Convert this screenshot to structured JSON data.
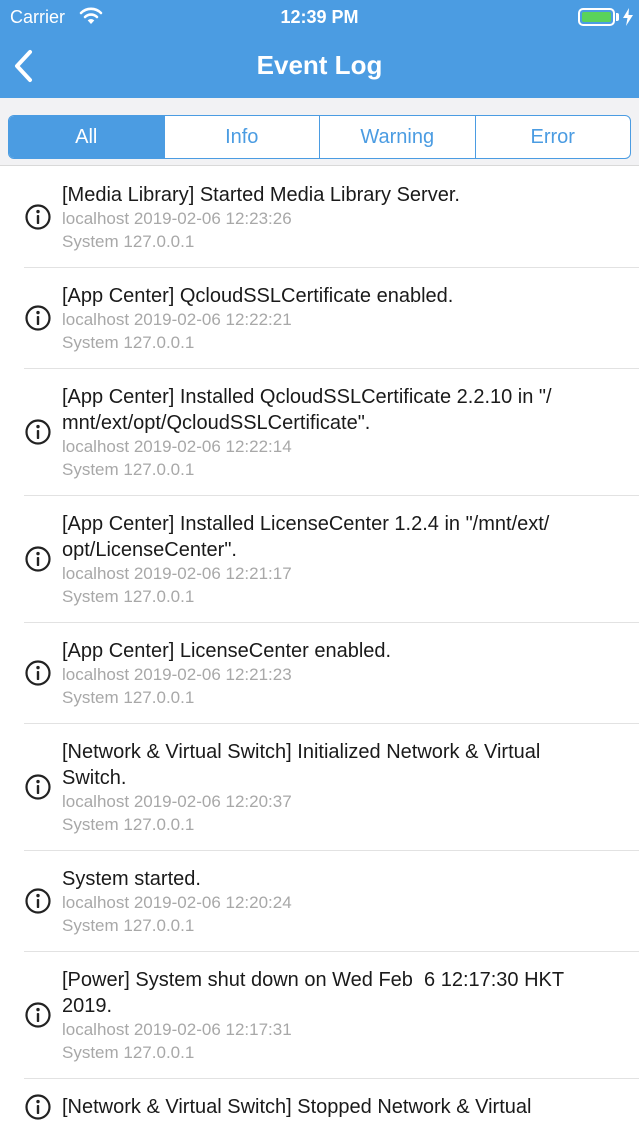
{
  "status_bar": {
    "carrier": "Carrier",
    "time": "12:39 PM",
    "battery_level": 1.0
  },
  "header": {
    "title": "Event Log"
  },
  "tabs": [
    {
      "label": "All",
      "active": true
    },
    {
      "label": "Info",
      "active": false
    },
    {
      "label": "Warning",
      "active": false
    },
    {
      "label": "Error",
      "active": false
    }
  ],
  "events": [
    {
      "icon": "info-icon",
      "message": "[Media Library] Started Media Library Server.",
      "host_time": "localhost 2019-02-06 12:23:26",
      "source": "System 127.0.0.1"
    },
    {
      "icon": "info-icon",
      "message": "[App Center] QcloudSSLCertificate enabled.",
      "host_time": "localhost 2019-02-06 12:22:21",
      "source": "System 127.0.0.1"
    },
    {
      "icon": "info-icon",
      "message": "[App Center] Installed QcloudSSLCertificate 2.2.10 in \"/\nmnt/ext/opt/QcloudSSLCertificate\".",
      "host_time": "localhost 2019-02-06 12:22:14",
      "source": "System 127.0.0.1"
    },
    {
      "icon": "info-icon",
      "message": "[App Center] Installed LicenseCenter 1.2.4 in \"/mnt/ext/\nopt/LicenseCenter\".",
      "host_time": "localhost 2019-02-06 12:21:17",
      "source": "System 127.0.0.1"
    },
    {
      "icon": "info-icon",
      "message": "[App Center] LicenseCenter enabled.",
      "host_time": "localhost 2019-02-06 12:21:23",
      "source": "System 127.0.0.1"
    },
    {
      "icon": "info-icon",
      "message": "[Network & Virtual Switch] Initialized Network & Virtual\nSwitch.",
      "host_time": "localhost 2019-02-06 12:20:37",
      "source": "System 127.0.0.1"
    },
    {
      "icon": "info-icon",
      "message": "System started.",
      "host_time": "localhost 2019-02-06 12:20:24",
      "source": "System 127.0.0.1"
    },
    {
      "icon": "info-icon",
      "message": "[Power] System shut down on Wed Feb  6 12:17:30 HKT\n2019.",
      "host_time": "localhost 2019-02-06 12:17:31",
      "source": "System 127.0.0.1"
    },
    {
      "icon": "info-icon",
      "message": "[Network & Virtual Switch] Stopped Network & Virtual",
      "host_time": "",
      "source": ""
    }
  ],
  "colors": {
    "accent": "#4b9ce2",
    "battery": "#5ad35a",
    "meta_text": "#a8a8a8"
  }
}
